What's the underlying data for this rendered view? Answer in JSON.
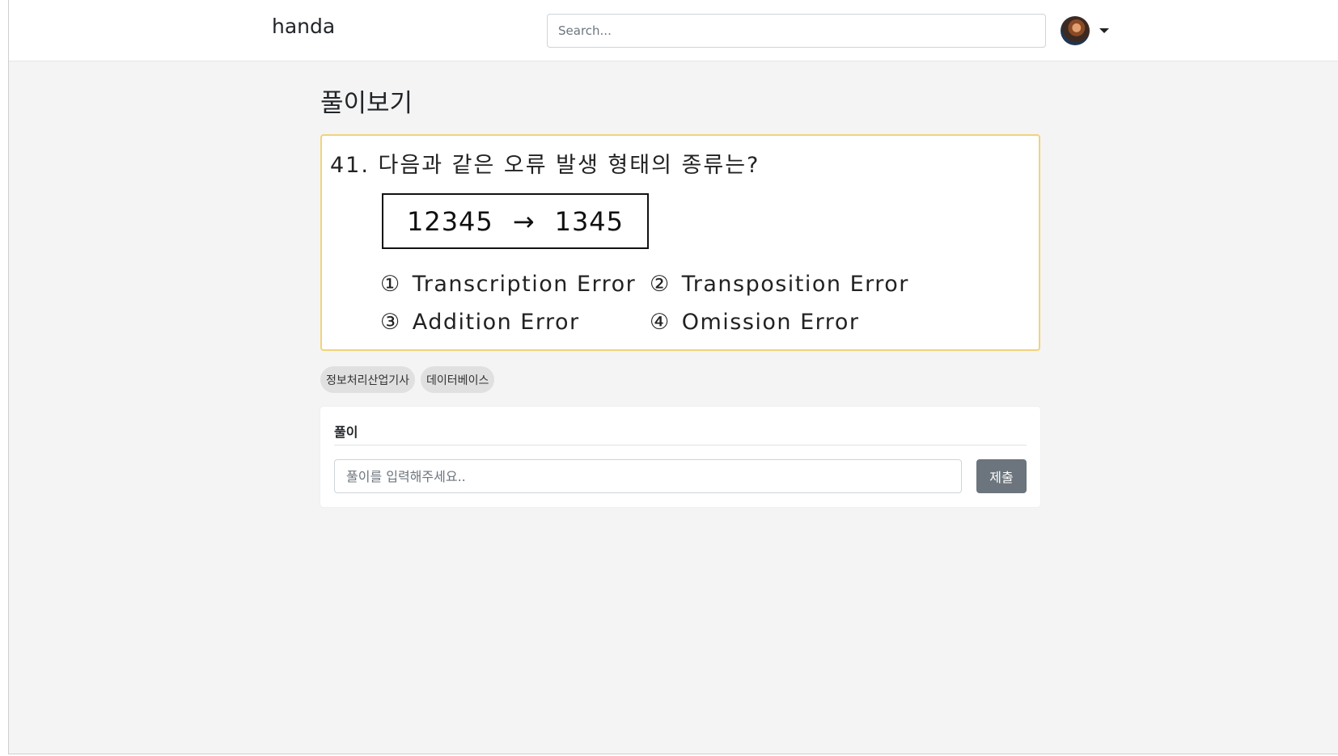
{
  "nav": {
    "brand": "handa",
    "search_placeholder": "Search..."
  },
  "page": {
    "title": "풀이보기"
  },
  "question": {
    "title": "41. 다음과 같은 오류 발생 형태의 종류는?",
    "sequence": {
      "from": "12345",
      "arrow": "→",
      "to": "1345"
    },
    "options": [
      {
        "num": "①",
        "label": "Transcription Error"
      },
      {
        "num": "②",
        "label": "Transposition Error"
      },
      {
        "num": "③",
        "label": "Addition Error"
      },
      {
        "num": "④",
        "label": "Omission Error"
      }
    ]
  },
  "tags": [
    "정보처리산업기사",
    "데이터베이스"
  ],
  "answer": {
    "header": "풀이",
    "placeholder": "풀이를 입력해주세요..",
    "submit_label": "제출"
  },
  "colors": {
    "question_border": "#f2d27a",
    "submit_button": "#6c757d",
    "tag_bg": "#e0e0e0",
    "page_bg": "#f4f4f4"
  }
}
